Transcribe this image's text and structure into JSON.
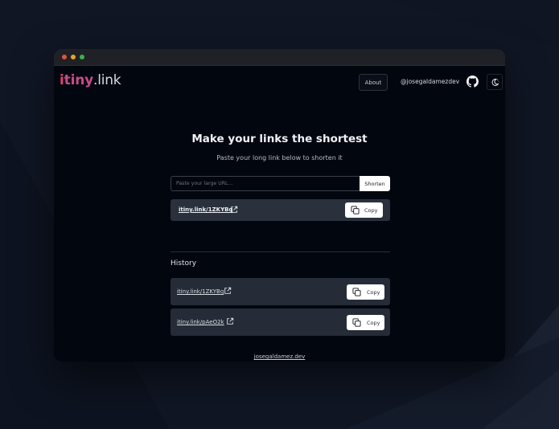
{
  "app": {
    "logo": {
      "i": "i",
      "tiny": "tiny",
      "link": ".link"
    },
    "nav": {
      "about_label": "About",
      "handle": "@josegaldamezdev",
      "github_icon": "github-icon",
      "theme_icon": "theme-toggle-icon"
    }
  },
  "hero": {
    "title": "Make your links the shortest",
    "subtitle": "Paste your long link below to shorten it"
  },
  "shortener": {
    "placeholder": "Paste your large URL...",
    "value": "",
    "submit_label": "Shorten"
  },
  "result": {
    "short_url": "itiny.link/1ZKYBq",
    "copy_label": "Copy"
  },
  "history": {
    "title": "History",
    "items": [
      {
        "short_url": "itiny.link/1ZKYBq",
        "copy_label": "Copy"
      },
      {
        "short_url": "itiny.link/pAeO2k",
        "copy_label": "Copy"
      }
    ]
  },
  "footer": {
    "link": "josegaldamez.dev"
  },
  "colors": {
    "background": "#101624",
    "window": "#02060f",
    "card": "#2a313d",
    "logo_i": "#e0436b",
    "logo_tiny": "#c94a8a",
    "traffic_red": "#e0533f",
    "traffic_yellow": "#e5a52b",
    "traffic_green": "#3cb24a"
  }
}
